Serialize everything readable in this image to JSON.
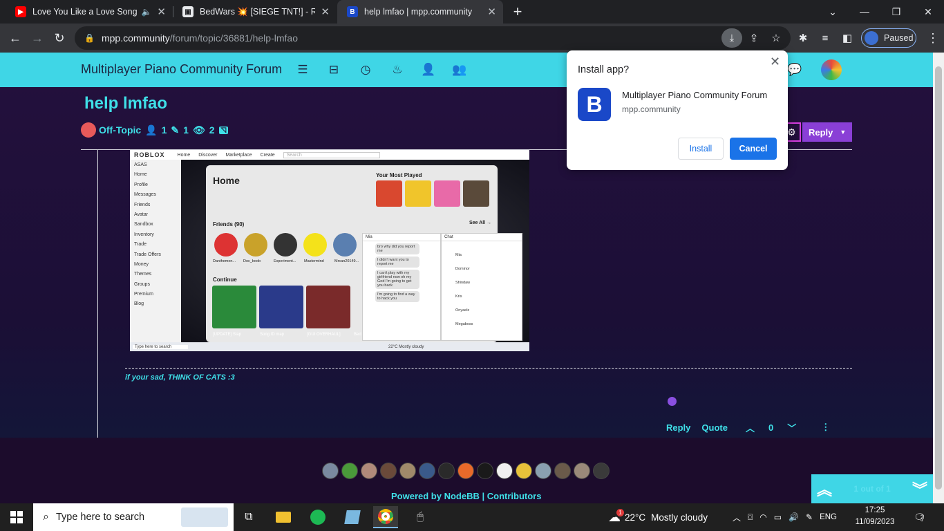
{
  "browser": {
    "tabs": [
      {
        "title": "Love You Like a Love Song (S",
        "icon": "youtube-icon",
        "active": false
      },
      {
        "title": "BedWars 💥 [SIEGE TNT!] - Roblo",
        "icon": "roblox-icon",
        "active": false
      },
      {
        "title": "help lmfao | mpp.community",
        "icon": "nodebb-icon",
        "active": true
      }
    ],
    "url_host": "mpp.community",
    "url_path": "/forum/topic/36881/help-lmfao",
    "profile_label": "Paused"
  },
  "forum": {
    "brand": "Multiplayer Piano Community Forum",
    "topic_title": "help lmfao",
    "category": "Off-Topic",
    "posters": "1",
    "posts": "1",
    "views": "2",
    "reply_label": "Reply",
    "signature": "if your sad, THINK OF CATS :3",
    "post_actions": {
      "reply": "Reply",
      "quote": "Quote",
      "votes": "0"
    },
    "powered_by": "Powered by NodeBB",
    "contributors": "Contributors",
    "pager_text": "1 out of 1"
  },
  "embedded": {
    "logo": "ROBLOX",
    "nav": [
      "Home",
      "Discover",
      "Marketplace",
      "Create"
    ],
    "search_placeholder": "Search",
    "user": "ASAS",
    "sidebar": [
      "Home",
      "Profile",
      "Messages",
      "Friends",
      "Avatar",
      "Sandbox",
      "Inventory",
      "Trade",
      "Trade Offers",
      "Money",
      "Themes",
      "Groups",
      "Premium",
      "Blog"
    ],
    "home_title": "Home",
    "most_played": "Your Most Played",
    "friends_title": "Friends (90)",
    "see_all": "See All →",
    "friend_names": [
      "Danthemen...",
      "Doc_boob",
      "Experiment...",
      "Mastermind",
      "Mrcan20149..."
    ],
    "continue_title": "Continue",
    "game_titles": [
      "[UPDATE] Slap",
      "Song ID map",
      "[GUI OVERHAUL]",
      "Bed"
    ],
    "chat_name": "Mia",
    "chat_messages": [
      "bro why did you report me",
      "I didn't want you to report me",
      "I can't play with my girlfriend now oh my God I'm going to get you back",
      "I'm going to find a way to hack you"
    ],
    "chat_list_title": "Chat",
    "chat_contacts": [
      "Mia",
      "Dominor",
      "Shindaw",
      "Kris",
      "Onyaelz",
      "Megaboss"
    ],
    "taskbar_search": "Type here to search",
    "weather": "22°C  Mostly cloudy"
  },
  "popup": {
    "title": "Install app?",
    "app_name": "Multiplayer Piano Community Forum",
    "app_host": "mpp.community",
    "app_icon_letter": "B",
    "install_label": "Install",
    "cancel_label": "Cancel"
  },
  "taskbar": {
    "search_placeholder": "Type here to search",
    "weather": "22°C",
    "weather_desc": "Mostly cloudy",
    "weather_badge": "1",
    "language": "ENG",
    "time": "17:25",
    "date": "11/09/2023",
    "notifications": "2"
  },
  "colors": {
    "accent": "#3fd6e6",
    "reply_button": "#8a3fd6",
    "chrome_blue": "#1a73e8"
  }
}
